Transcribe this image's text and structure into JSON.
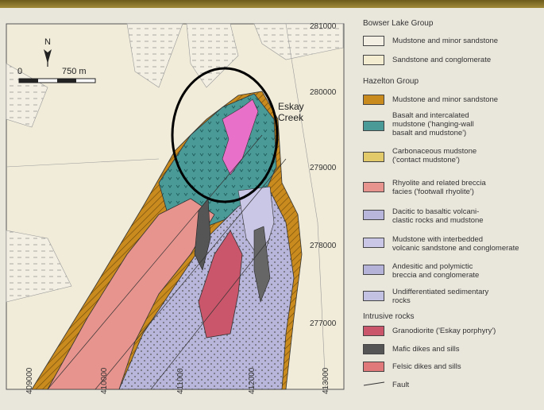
{
  "map": {
    "north_label": "N",
    "scale_start": "0",
    "scale_end": "750 m",
    "place_label_line1": "Eskay",
    "place_label_line2": "Creek",
    "y_ticks": [
      "281000",
      "280000",
      "279000",
      "278000",
      "277000"
    ],
    "x_ticks": [
      "409000",
      "410000",
      "411000",
      "412000",
      "413000"
    ]
  },
  "legend": {
    "group1": "Bowser Lake Group",
    "group1_items": [
      {
        "label1": "Mudstone and minor sandstone",
        "label2": "",
        "color": "#f3efe2"
      },
      {
        "label1": "Sandstone and conglomerate",
        "label2": "",
        "color": "#f3ecd0"
      }
    ],
    "group2": "Hazelton Group",
    "group2_items": [
      {
        "label1": "Mudstone and minor sandstone",
        "label2": "",
        "color": "#c98a1e"
      },
      {
        "label1": "Basalt and intercalated",
        "label2": "mudstone ('hanging-wall",
        "label3": "basalt and mudstone')",
        "color": "#4a9a98"
      },
      {
        "label1": "Carbonaceous mudstone",
        "label2": "('contact mudstone')",
        "color": "#e2c96a"
      },
      {
        "label1": "Rhyolite and related breccia",
        "label2": "facies ('footwall rhyolite')",
        "color": "#e8948e"
      },
      {
        "label1": "Dacitic to basaltic volcani-",
        "label2": "clastic rocks and mudstone",
        "color": "#b8b6da"
      },
      {
        "label1": "Mudstone with interbedded",
        "label2": "volcanic sandstone and conglomerate",
        "color": "#c9c6e6"
      },
      {
        "label1": "Andesitic and polymictic",
        "label2": "breccia and conglomerate",
        "color": "#b6b3d8"
      },
      {
        "label1": "Undifferentiated sedimentary",
        "label2": "rocks",
        "color": "#c4c2e2"
      }
    ],
    "group3": "Intrusive rocks",
    "group3_items": [
      {
        "label1": "Granodiorite ('Eskay porphyry')",
        "label2": "",
        "color": "#c9566a"
      },
      {
        "label1": "Mafic dikes and sills",
        "label2": "",
        "color": "#555555"
      },
      {
        "label1": "Felsic dikes and sills",
        "label2": "",
        "color": "#e07a7a"
      }
    ],
    "fault_label": "Fault"
  }
}
